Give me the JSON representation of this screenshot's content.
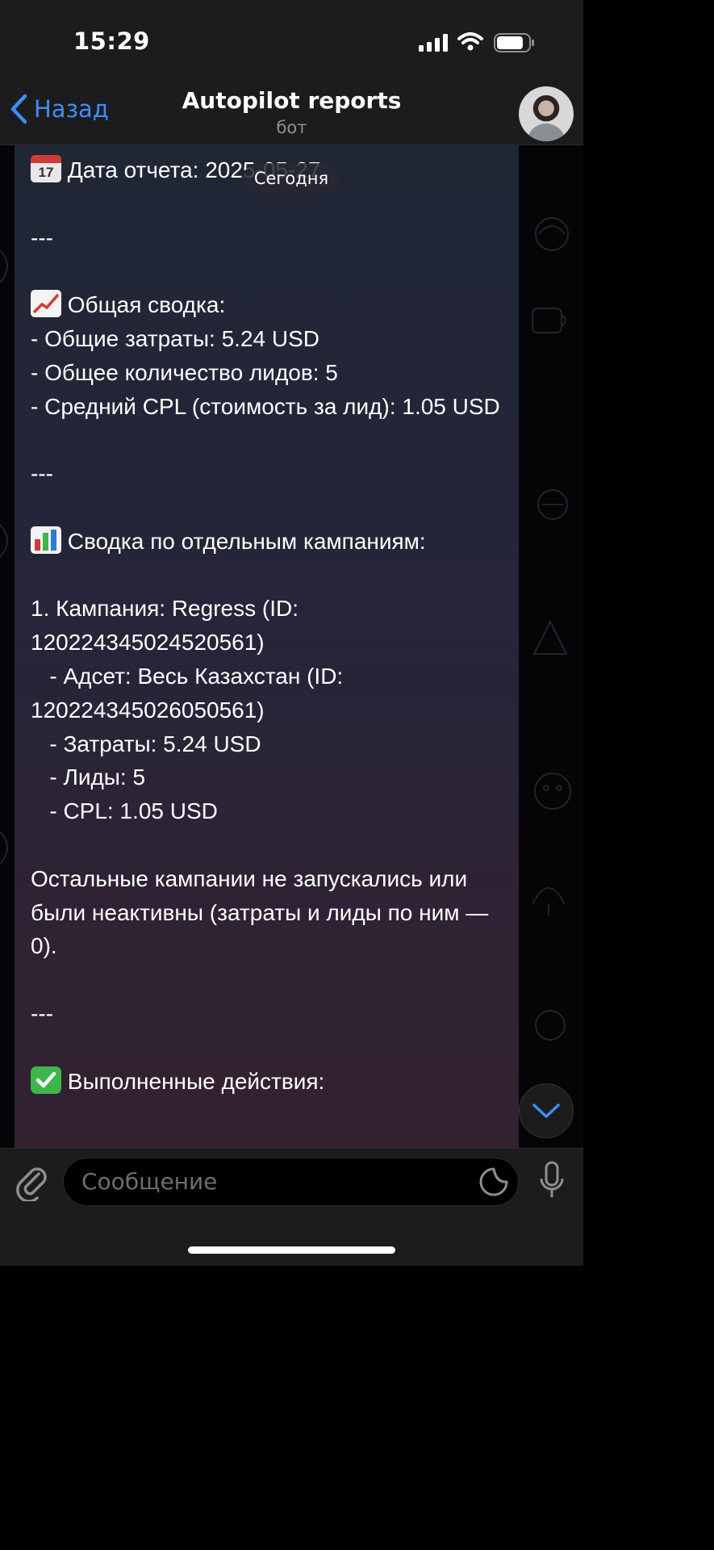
{
  "status_bar": {
    "time": "15:29"
  },
  "nav": {
    "back_label": "Назад",
    "title": "Autopilot reports",
    "subtitle": "бот"
  },
  "date_pill": "Сегодня",
  "message": {
    "report_date_label": "Дата отчета: 2025-05-27",
    "sep1": "---",
    "summary_title": "Общая сводка:",
    "summary_lines": [
      "- Общие затраты: 5.24 USD",
      "- Общее количество лидов: 5",
      "- Средний CPL (стоимость за лид): 1.05 USD"
    ],
    "sep2": "---",
    "campaigns_title": "Сводка по отдельным кампаниям:",
    "campaign_lines": [
      "1. Кампания: Regress (ID: 120224345024520561)",
      "   - Адсет: Весь Казахстан (ID: 120224345026050561)",
      "   - Затраты: 5.24 USD",
      "   - Лиды: 5",
      "   - CPL: 1.05 USD"
    ],
    "other_note": "Остальные кампании не запускались или были неактивны (затраты и лиды по ним — 0).",
    "sep3": "---",
    "actions_title": "Выполненные действия:"
  },
  "input": {
    "placeholder": "Сообщение"
  },
  "icons": {
    "back": "chevron-left-icon",
    "attach": "paperclip-icon",
    "sticker": "sticker-icon",
    "mic": "microphone-icon",
    "scroll": "chevron-down-icon"
  },
  "colors": {
    "accent": "#3e8ef5",
    "bar_bg": "#1c1c1e"
  }
}
